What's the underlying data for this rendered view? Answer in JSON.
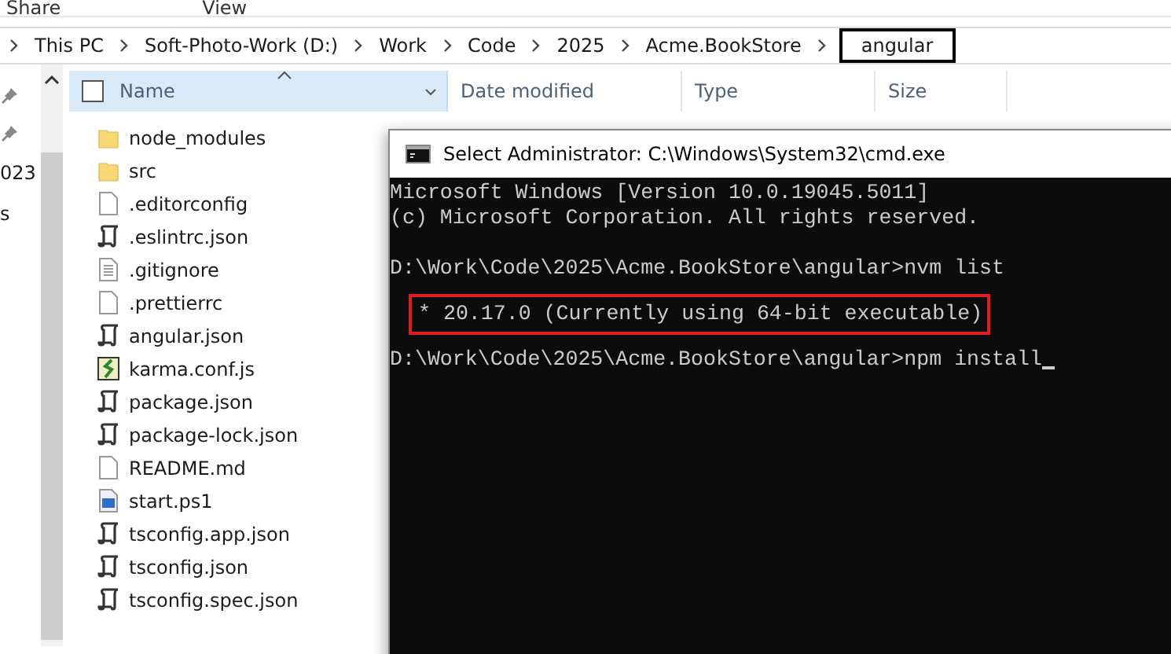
{
  "ribbon_tabs": [
    "Share",
    "View"
  ],
  "breadcrumb": [
    {
      "label": "This PC",
      "selected": false
    },
    {
      "label": "Soft-Photo-Work (D:)",
      "selected": false
    },
    {
      "label": "Work",
      "selected": false
    },
    {
      "label": "Code",
      "selected": false
    },
    {
      "label": "2025",
      "selected": false
    },
    {
      "label": "Acme.BookStore",
      "selected": false
    },
    {
      "label": "angular",
      "selected": true
    }
  ],
  "nav_items": [
    "023",
    "s"
  ],
  "columns": [
    {
      "label": "Name",
      "sorted": true
    },
    {
      "label": "Date modified",
      "sorted": false
    },
    {
      "label": "Type",
      "sorted": false
    },
    {
      "label": "Size",
      "sorted": false
    }
  ],
  "files": [
    {
      "name": "node_modules",
      "kind": "folder"
    },
    {
      "name": "src",
      "kind": "folder"
    },
    {
      "name": ".editorconfig",
      "kind": "file"
    },
    {
      "name": ".eslintrc.json",
      "kind": "script"
    },
    {
      "name": ".gitignore",
      "kind": "text"
    },
    {
      "name": ".prettierrc",
      "kind": "file"
    },
    {
      "name": "angular.json",
      "kind": "script"
    },
    {
      "name": "karma.conf.js",
      "kind": "js"
    },
    {
      "name": "package.json",
      "kind": "script"
    },
    {
      "name": "package-lock.json",
      "kind": "script"
    },
    {
      "name": "README.md",
      "kind": "file"
    },
    {
      "name": "start.ps1",
      "kind": "ps"
    },
    {
      "name": "tsconfig.app.json",
      "kind": "script"
    },
    {
      "name": "tsconfig.json",
      "kind": "script"
    },
    {
      "name": "tsconfig.spec.json",
      "kind": "script"
    }
  ],
  "terminal": {
    "title": "Select Administrator: C:\\Windows\\System32\\cmd.exe",
    "lines": [
      {
        "text": "Microsoft Windows [Version 10.0.19045.5011]",
        "kind": "output",
        "cursor": false
      },
      {
        "text": "(c) Microsoft Corporation. All rights reserved.",
        "kind": "output",
        "cursor": false
      },
      {
        "text": "D:\\Work\\Code\\2025\\Acme.BookStore\\angular>nvm list",
        "kind": "prompt",
        "cursor": false
      },
      {
        "text": "* 20.17.0 (Currently using 64-bit executable)",
        "kind": "highlighted",
        "cursor": false
      },
      {
        "text": "D:\\Work\\Code\\2025\\Acme.BookStore\\angular>npm install",
        "kind": "prompt",
        "cursor": true
      }
    ]
  }
}
